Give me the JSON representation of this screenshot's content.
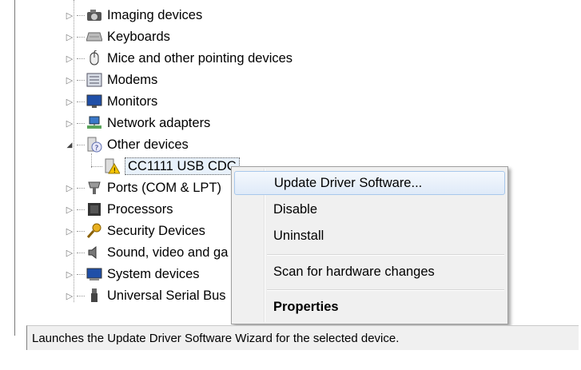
{
  "tree": {
    "items": [
      {
        "label": "Imaging devices",
        "icon": "camera-icon",
        "expander": "▷"
      },
      {
        "label": "Keyboards",
        "icon": "keyboard-icon",
        "expander": "▷"
      },
      {
        "label": "Mice and other pointing devices",
        "icon": "mouse-icon",
        "expander": "▷"
      },
      {
        "label": "Modems",
        "icon": "modem-icon",
        "expander": "▷"
      },
      {
        "label": "Monitors",
        "icon": "monitor-icon",
        "expander": "▷"
      },
      {
        "label": "Network adapters",
        "icon": "network-icon",
        "expander": "▷"
      },
      {
        "label": "Other devices",
        "icon": "unknown-device-icon",
        "expander": "◢"
      },
      {
        "label": "CC1111 USB CDC",
        "icon": "warning-device-icon",
        "expander": ""
      },
      {
        "label": "Ports (COM & LPT)",
        "icon": "port-icon",
        "expander": "▷"
      },
      {
        "label": "Processors",
        "icon": "processor-icon",
        "expander": "▷"
      },
      {
        "label": "Security Devices",
        "icon": "key-icon",
        "expander": "▷"
      },
      {
        "label": "Sound, video and ga",
        "icon": "speaker-icon",
        "expander": "▷"
      },
      {
        "label": "System devices",
        "icon": "system-icon",
        "expander": "▷"
      },
      {
        "label": "Universal Serial Bus",
        "icon": "usb-icon",
        "expander": "▷"
      }
    ]
  },
  "context_menu": {
    "items": [
      {
        "label": "Update Driver Software...",
        "highlighted": true
      },
      {
        "label": "Disable"
      },
      {
        "label": "Uninstall"
      },
      {
        "label": "Scan for hardware changes"
      },
      {
        "label": "Properties",
        "bold": true
      }
    ]
  },
  "statusbar": {
    "text": "Launches the Update Driver Software Wizard for the selected device."
  },
  "colors": {
    "highlight_border": "#a8c8ec",
    "menu_bg": "#f0f0f0",
    "warning": "#f5c400"
  }
}
